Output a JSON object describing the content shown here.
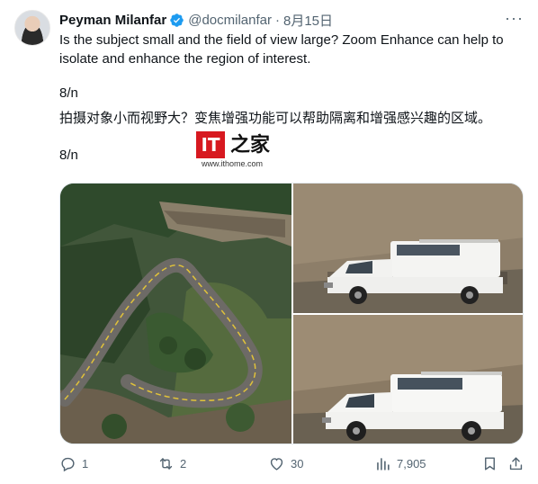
{
  "tweet": {
    "author_name": "Peyman Milanfar",
    "handle": "@docmilanfar",
    "separator": "·",
    "date": "8月15日",
    "paragraph1": "Is the subject small and the field of view large? Zoom Enhance can help to isolate and enhance the region of interest.",
    "counter1": "8/n",
    "paragraph2": "拍摄对象小而视野大？变焦增强功能可以帮助隔离和增强感兴趣的区域。",
    "counter2": "8/n"
  },
  "watermark": {
    "logo_text": "IT",
    "logo_cn": "之家",
    "url": "www.ithome.com"
  },
  "media": {
    "images": [
      "winding-road-aerial",
      "truck-closeup-original",
      "truck-closeup-enhanced"
    ]
  },
  "actions": {
    "replies": "1",
    "retweets": "2",
    "likes": "30",
    "views": "7,905"
  },
  "colors": {
    "verified": "#1d9bf0",
    "muted": "#536471",
    "text": "#0f1419"
  }
}
